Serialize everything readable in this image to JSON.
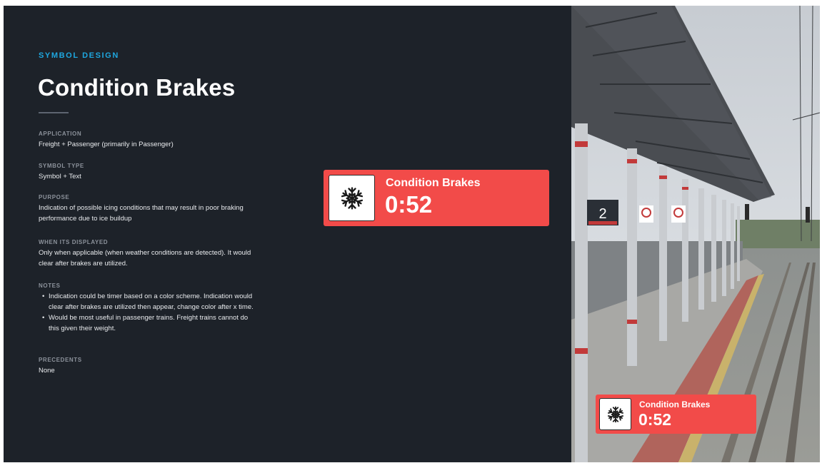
{
  "header": {
    "eyebrow": "SYMBOL DESIGN",
    "title": "Condition Brakes"
  },
  "details": {
    "application": {
      "label": "APPLICATION",
      "value": "Freight + Passenger (primarily in Passenger)"
    },
    "symbol_type": {
      "label": "SYMBOL TYPE",
      "value": "Symbol + Text"
    },
    "purpose": {
      "label": "PURPOSE",
      "value": "Indication of possible icing conditions that may result in poor braking performance due to ice buildup"
    },
    "when_displayed": {
      "label": "WHEN ITS DISPLAYED",
      "value": "Only when applicable (when weather conditions are detected). It would clear after brakes are utilized."
    },
    "notes": {
      "label": "NOTES",
      "items": [
        "Indication could be timer based on a color scheme. Indication would clear after brakes are utilized then appear, change color after x time.",
        "Would be most useful in passenger trains. Freight trains cannot do this given their weight."
      ]
    },
    "precedents": {
      "label": "PRECEDENTS",
      "value": "None"
    }
  },
  "alert_large": {
    "icon": "snowflake-icon",
    "name": "Condition Brakes",
    "timer": "0:52"
  },
  "alert_small": {
    "icon": "snowflake-icon",
    "name": "Condition Brakes",
    "timer": "0:52"
  },
  "photo": {
    "platform_number": "2"
  },
  "colors": {
    "background": "#1d2229",
    "accent": "#1ea7df",
    "alert_red": "#f24b49",
    "icon_bg": "#ffffff"
  }
}
